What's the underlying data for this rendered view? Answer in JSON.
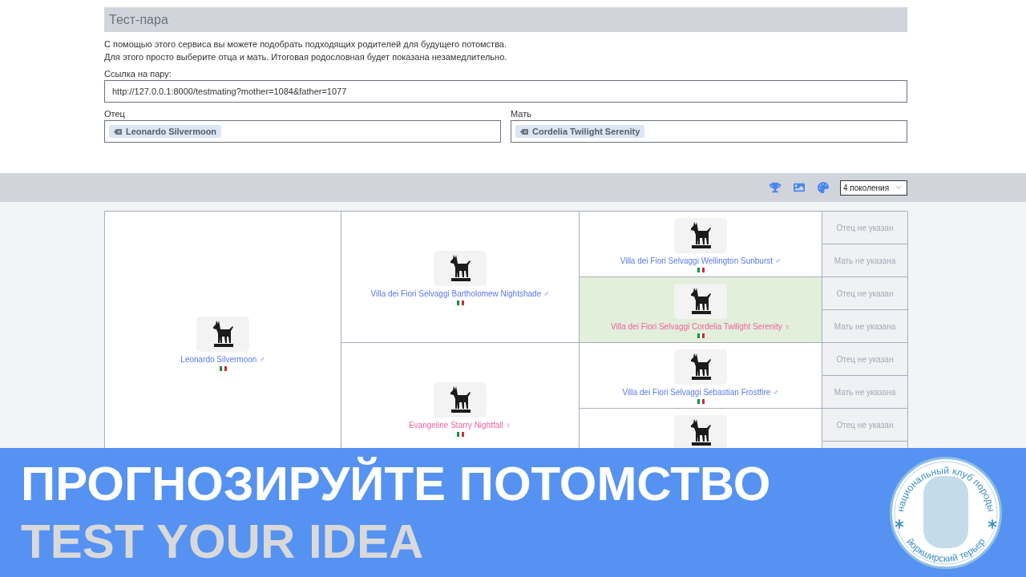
{
  "page": {
    "title": "Тест-пара",
    "intro": [
      "С помощью этого сервиса вы можете подобрать подходящих родителей для будущего потомства.",
      "Для этого просто выберите отца и мать. Итоговая родословная будет показана незамедлительно."
    ]
  },
  "link": {
    "label": "Ссылка на пару:",
    "value": "http://127.0.0.1:8000/testmating?mother=1084&father=1077"
  },
  "parents": [
    {
      "label": "Отец",
      "selected_dog": "Leonardo Silvermoon"
    },
    {
      "label": "Мать",
      "selected_dog": "Cordelia Twilight Serenity"
    }
  ],
  "toolbar": {
    "generations": "4 поколения"
  },
  "pedigree": {
    "root": {
      "kind": "dog",
      "name": "Leonardo Silvermoon ♂",
      "female": false,
      "highlighted": false,
      "children": [
        {
          "kind": "dog",
          "name": "Villa dei Fiori Selvaggi Bartholomew Nightshade ♂",
          "female": false,
          "highlighted": false,
          "children": [
            {
              "kind": "dog",
              "name": "Villa dei Fiori Selvaggi Wellington Sunburst ♂",
              "female": false,
              "highlighted": false,
              "children": [
                {
                  "kind": "unknown",
                  "text": "Отец не указан"
                },
                {
                  "kind": "unknown",
                  "text": "Мать не указана"
                }
              ]
            },
            {
              "kind": "dog",
              "name": "Villa dei Fiori Selvaggi Cordelia Twilight Serenity ♀",
              "female": true,
              "highlighted": true,
              "children": [
                {
                  "kind": "unknown",
                  "text": "Отец не указан"
                },
                {
                  "kind": "unknown",
                  "text": "Мать не указана"
                }
              ]
            }
          ]
        },
        {
          "kind": "dog",
          "name": "Evangeline Starry Nightfall ♀",
          "female": true,
          "highlighted": false,
          "children": [
            {
              "kind": "dog",
              "name": "Villa dei Fiori Selvaggi Sebastian Frostfire ♂",
              "female": false,
              "highlighted": false,
              "children": [
                {
                  "kind": "unknown",
                  "text": "Отец не указан"
                },
                {
                  "kind": "unknown",
                  "text": "Мать не указана"
                }
              ]
            },
            {
              "kind": "dog",
              "highlighted": false,
              "children": [
                {
                  "kind": "unknown",
                  "text": "Отец не указан"
                },
                {
                  "kind": "unknown"
                }
              ]
            }
          ]
        }
      ]
    }
  },
  "banner": {
    "headline": "ПРОГНОЗИРУЙТЕ ПОТОМСТВО",
    "subheadline": "TEST YOUR IDEA",
    "badge": {
      "top_text": "национальный клуб породы",
      "bottom_text": "йоркширский терьер"
    }
  }
}
